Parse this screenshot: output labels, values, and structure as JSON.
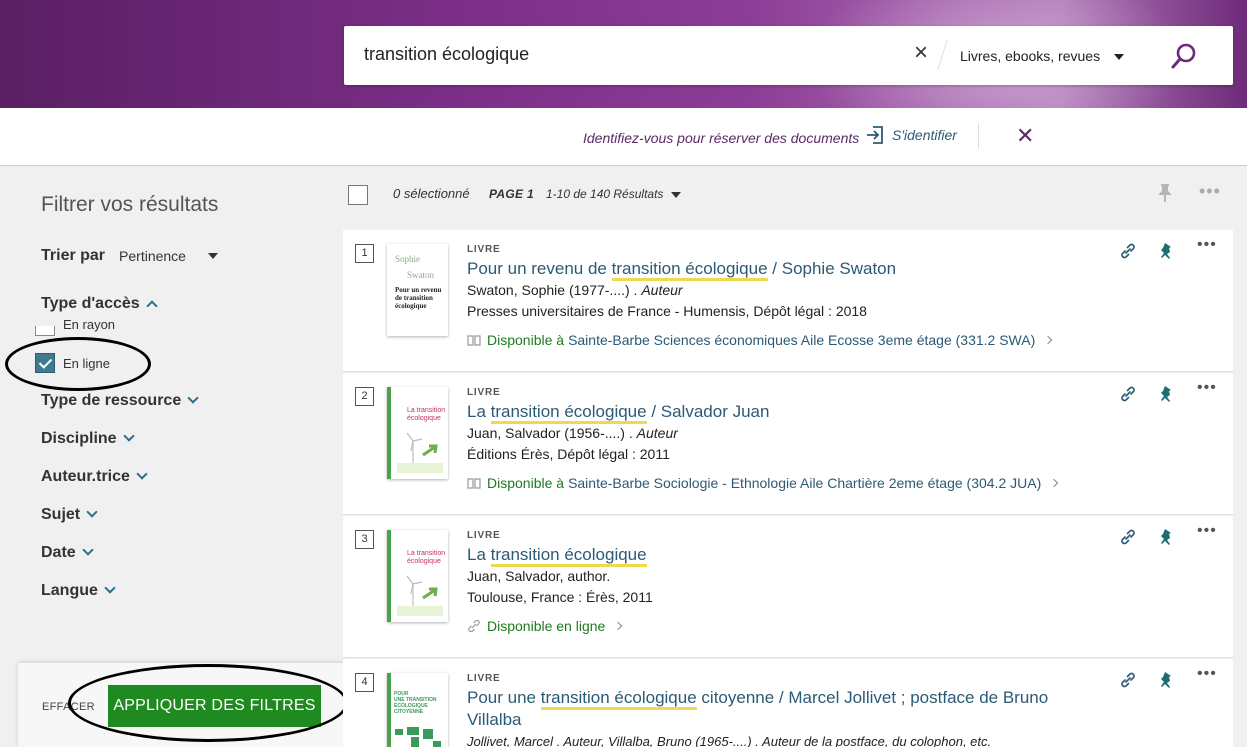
{
  "search": {
    "query": "transition écologique",
    "scope": "Livres, ebooks, revues"
  },
  "login": {
    "message": "Identifiez-vous pour réserver des documents",
    "link": "S'identifier"
  },
  "sidebar": {
    "title": "Filtrer vos résultats",
    "sort_label": "Trier par",
    "sort_value": "Pertinence",
    "facets": {
      "access": "Type d'accès",
      "resource": "Type de ressource",
      "discipline": "Discipline",
      "author": "Auteur.trice",
      "subject": "Sujet",
      "date": "Date",
      "language": "Langue"
    },
    "access_options": [
      "En rayon",
      "En ligne"
    ],
    "clear_label": "EFFACER",
    "apply_label": "APPLIQUER DES FILTRES"
  },
  "toolbar": {
    "selected": "0 sélectionné",
    "page": "PAGE 1",
    "count": "1-10 de 140 Résultats"
  },
  "results": [
    {
      "num": "1",
      "type": "LIVRE",
      "title_pre": "Pour un revenu de ",
      "title_hl": "transition écologique",
      "title_post": " / Sophie Swaton",
      "author": "Swaton, Sophie (1977-....) . ",
      "role": "Auteur",
      "publisher": "Presses universitaires de France - Humensis, Dépôt légal : 2018",
      "avail": "Disponible à",
      "location": "Sainte-Barbe  Sciences économiques Aile Ecosse 3eme étage (331.2 SWA)",
      "cover_lines": [
        "Sophie",
        "Swaton",
        "Pour un revenu",
        "de transition",
        "écologique"
      ]
    },
    {
      "num": "2",
      "type": "LIVRE",
      "title_pre": "La ",
      "title_hl": "transition écologique",
      "title_post": " / Salvador Juan",
      "author": "Juan, Salvador (1956-....) . ",
      "role": "Auteur",
      "publisher": "Éditions Érès, Dépôt légal : 2011",
      "avail": "Disponible à",
      "location": "Sainte-Barbe  Sociologie - Ethnologie Aile Chartière 2eme étage (304.2 JUA)",
      "cover_lines": [
        "La transition",
        "écologique"
      ]
    },
    {
      "num": "3",
      "type": "LIVRE",
      "title_pre": "La ",
      "title_hl": "transition écologique",
      "title_post": "",
      "author": "Juan, Salvador, author.",
      "role": "",
      "publisher": "Toulouse, France : Érès, 2011",
      "avail": "Disponible en ligne",
      "location": "",
      "cover_lines": [
        "La transition",
        "écologique"
      ]
    },
    {
      "num": "4",
      "type": "LIVRE",
      "title_pre": "Pour une ",
      "title_hl": "transition écologique",
      "title_post": " citoyenne / Marcel Jollivet ; postface de Bruno Villalba",
      "author": "Jollivet, Marcel . Auteur, Villalba, Bruno (1965-....) . Auteur de la postface, du colophon, etc.",
      "role": "",
      "publisher": "",
      "avail": "",
      "location": "",
      "cover_lines": [
        "POUR",
        "UNE TRANSITION",
        "ÉCOLOGIQUE CITOYENNE"
      ]
    }
  ],
  "colors": {
    "header": "#7a2e86",
    "link": "#2c5a76",
    "available": "#1f7a1f",
    "apply": "#1f8a1f",
    "highlight": "#f0d850",
    "accent": "#5b2a66"
  }
}
